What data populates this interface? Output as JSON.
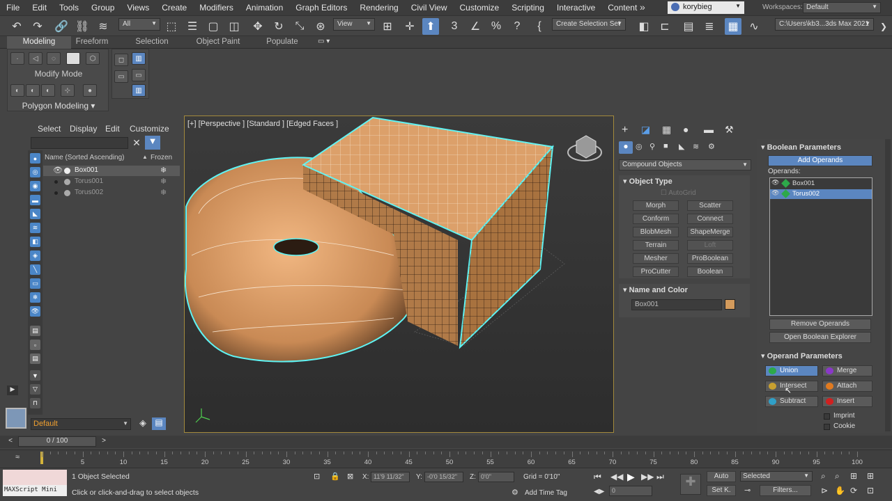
{
  "menubar": {
    "items": [
      "File",
      "Edit",
      "Tools",
      "Group",
      "Views",
      "Create",
      "Modifiers",
      "Animation",
      "Graph Editors",
      "Rendering",
      "Civil View",
      "Customize",
      "Scripting",
      "Interactive",
      "Content"
    ],
    "overflow": "»",
    "user": "korybieg",
    "workspaces_label": "Workspaces:",
    "workspace_value": "Default"
  },
  "toolbar": {
    "filter_value": "All",
    "view_value": "View",
    "named_selection": "Create Selection Set",
    "project_path": "C:\\Users\\kb3...3ds Max 2021"
  },
  "ribbon": {
    "tabs": [
      "Modeling",
      "Freeform",
      "Selection",
      "Object Paint",
      "Populate"
    ],
    "modify_mode": "Modify Mode",
    "polygon_modeling": "Polygon Modeling ▾"
  },
  "scene_explorer": {
    "menus": [
      "Select",
      "Display",
      "Edit",
      "Customize"
    ],
    "search_placeholder": "",
    "col_name": "Name (Sorted Ascending)",
    "col_frozen": "Frozen",
    "rows": [
      "Box001",
      "Torus001",
      "Torus002"
    ],
    "layer": "Default"
  },
  "viewport": {
    "label": "[+] [Perspective ] [Standard ] [Edged Faces ]"
  },
  "command_panel": {
    "category": "Compound Objects",
    "object_type_title": "Object Type",
    "autogrid": "AutoGrid",
    "buttons": [
      "Morph",
      "Scatter",
      "Conform",
      "Connect",
      "BlobMesh",
      "ShapeMerge",
      "Terrain",
      "Loft",
      "Mesher",
      "ProBoolean",
      "ProCutter",
      "Boolean"
    ],
    "name_color_title": "Name and Color",
    "object_name": "Box001",
    "object_color": "#d49b5c"
  },
  "boolean": {
    "title": "Boolean Parameters",
    "add_operands": "Add Operands",
    "operands_label": "Operands:",
    "operands": [
      "Box001",
      "Torus002"
    ],
    "remove_operands": "Remove Operands",
    "open_explorer": "Open Boolean Explorer",
    "operand_params_title": "Operand Parameters",
    "ops": [
      "Union",
      "Merge",
      "Intersect",
      "Attach",
      "Subtract",
      "Insert"
    ],
    "imprint": "Imprint",
    "cookie": "Cookie"
  },
  "timeline": {
    "frame_counter": "0 / 100",
    "ticks": [
      "5",
      "10",
      "15",
      "20",
      "25",
      "30",
      "35",
      "40",
      "45",
      "50",
      "55",
      "60",
      "65",
      "70",
      "75",
      "80",
      "85",
      "90",
      "95",
      "100"
    ]
  },
  "status": {
    "maxscript": "MAXScript Mini",
    "selected": "1 Object Selected",
    "prompt": "Click or click-and-drag to select objects",
    "x_label": "X:",
    "x_value": "11'9 11/32\"",
    "y_label": "Y:",
    "y_value": "-0'0 15/32\"",
    "z_label": "Z:",
    "z_value": "0'0\"",
    "grid": "Grid = 0'10\"",
    "add_time_tag": "Add Time Tag",
    "auto": "Auto",
    "set_key": "Set K.",
    "key_filter": "Selected",
    "frame": "0",
    "filters": "Filters..."
  }
}
